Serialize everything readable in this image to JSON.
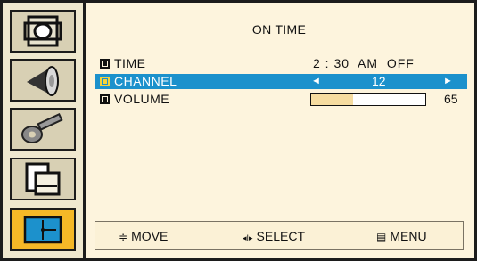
{
  "menu": {
    "title": "ON TIME",
    "rows": [
      {
        "label": "TIME",
        "value": "2 : 30  AM  OFF"
      },
      {
        "label": "CHANNEL",
        "left_arrow": "◄",
        "value": "12",
        "right_arrow": "►"
      },
      {
        "label": "VOLUME",
        "value": "65",
        "level_percent": 37
      }
    ]
  },
  "sidebar": {
    "items": [
      {
        "icon": "picture-icon"
      },
      {
        "icon": "speaker-icon"
      },
      {
        "icon": "key-icon"
      },
      {
        "icon": "window-icon"
      },
      {
        "icon": "setup-icon",
        "active": true
      }
    ]
  },
  "help": {
    "move_icon": "≑",
    "move_label": "MOVE",
    "select_icon": "◂I▸",
    "select_label": "SELECT",
    "menu_icon": "▤",
    "menu_label": "MENU"
  },
  "colors": {
    "highlight": "#1c91cc",
    "active_icon_bg": "#f5b827",
    "background": "#fdf4dd",
    "volume_fill": "#f6dca0"
  }
}
